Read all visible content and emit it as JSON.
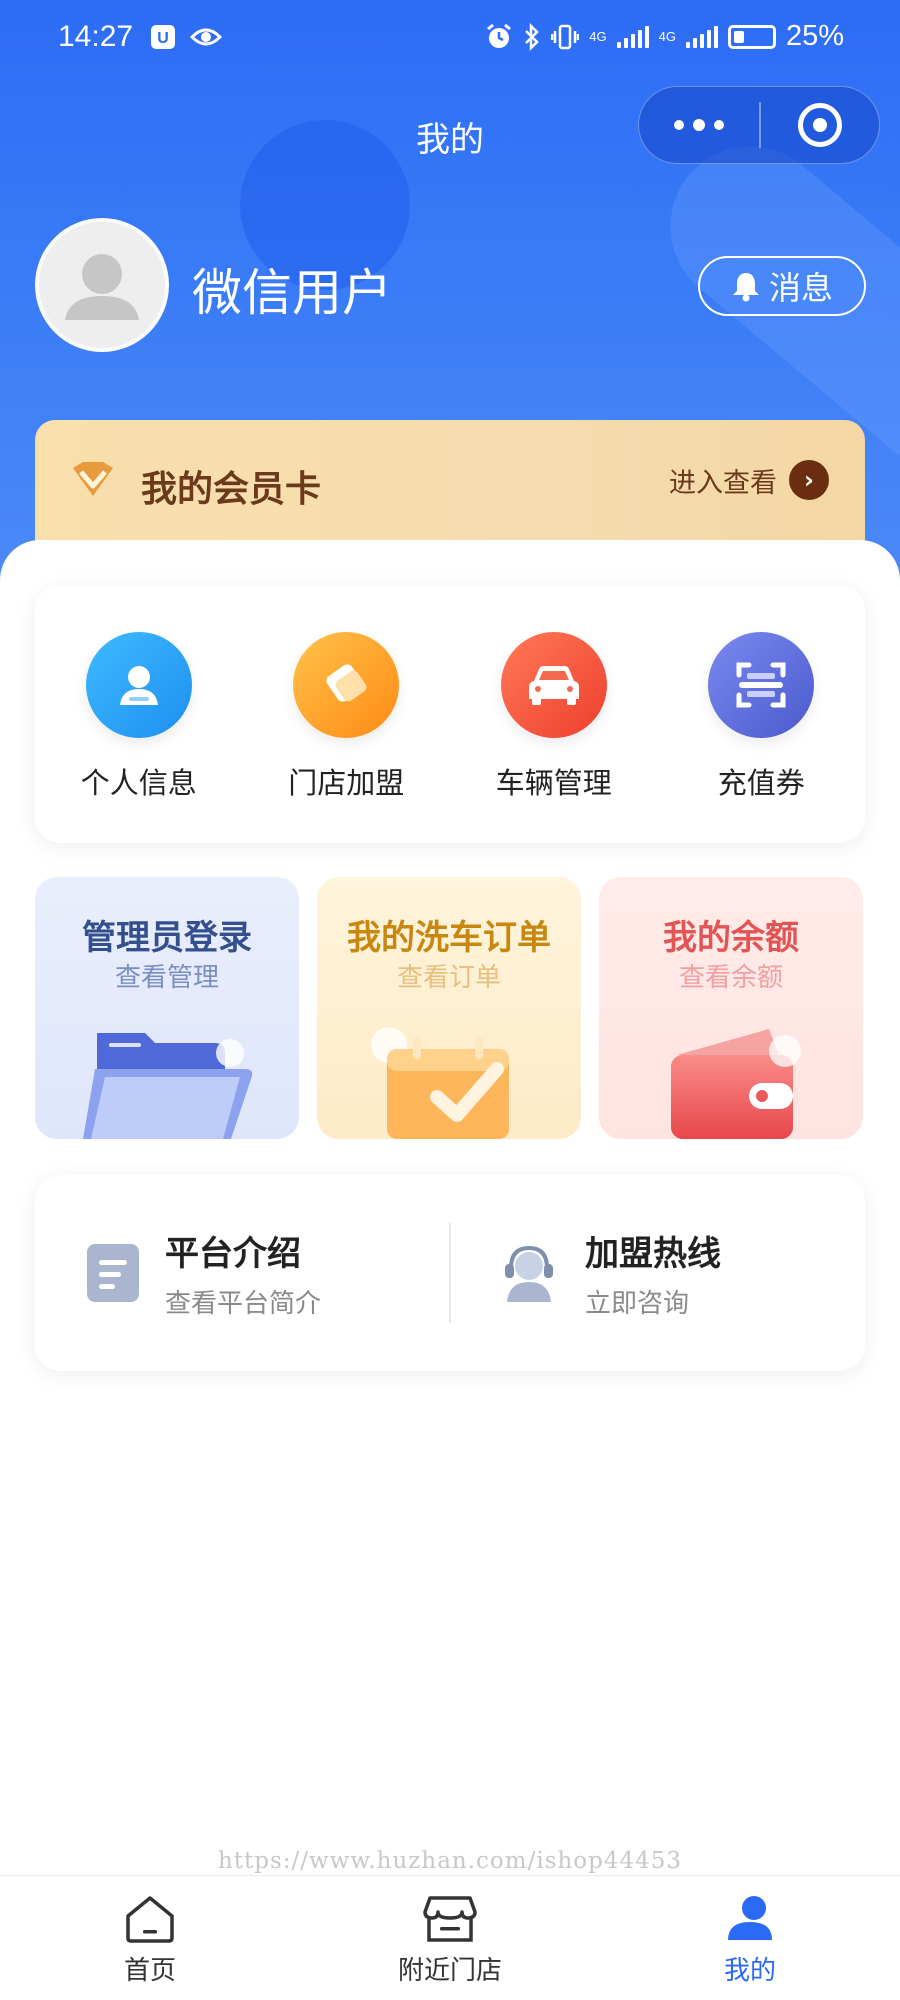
{
  "status_bar": {
    "time": "14:27",
    "network_1": "4G",
    "network_2": "4G",
    "battery": "25%"
  },
  "header": {
    "title": "我的",
    "capsule_more": "more-dots-icon",
    "capsule_close": "target-icon"
  },
  "profile": {
    "username": "微信用户",
    "message_label": "消息"
  },
  "vip_card": {
    "title": "我的会员卡",
    "action_label": "进入查看"
  },
  "quick_actions": [
    {
      "label": "个人信息",
      "icon": "person-icon",
      "color": "#2aa4f4"
    },
    {
      "label": "门店加盟",
      "icon": "handshake-icon",
      "color": "#ff9f1c"
    },
    {
      "label": "车辆管理",
      "icon": "car-icon",
      "color": "#f2503a"
    },
    {
      "label": "充值券",
      "icon": "scan-icon",
      "color": "#5b6bdc"
    }
  ],
  "tiles": [
    {
      "title": "管理员登录",
      "subtitle": "查看管理",
      "title_color": "#334f8e",
      "sub_color": "#7a8fc0"
    },
    {
      "title": "我的洗车订单",
      "subtitle": "查看订单",
      "title_color": "#c8870e",
      "sub_color": "#e5c07e"
    },
    {
      "title": "我的余额",
      "subtitle": "查看余额",
      "title_color": "#e25555",
      "sub_color": "#f0a0a0"
    }
  ],
  "info": [
    {
      "title": "平台介绍",
      "subtitle": "查看平台简介"
    },
    {
      "title": "加盟热线",
      "subtitle": "立即咨询"
    }
  ],
  "watermark": "https://www.huzhan.com/ishop44453",
  "tabbar": [
    {
      "label": "首页",
      "icon": "home-icon",
      "active": false
    },
    {
      "label": "附近门店",
      "icon": "store-icon",
      "active": false
    },
    {
      "label": "我的",
      "icon": "user-icon",
      "active": true
    }
  ],
  "colors": {
    "primary": "#2b6af5",
    "vip_text": "#6b3a1c"
  }
}
